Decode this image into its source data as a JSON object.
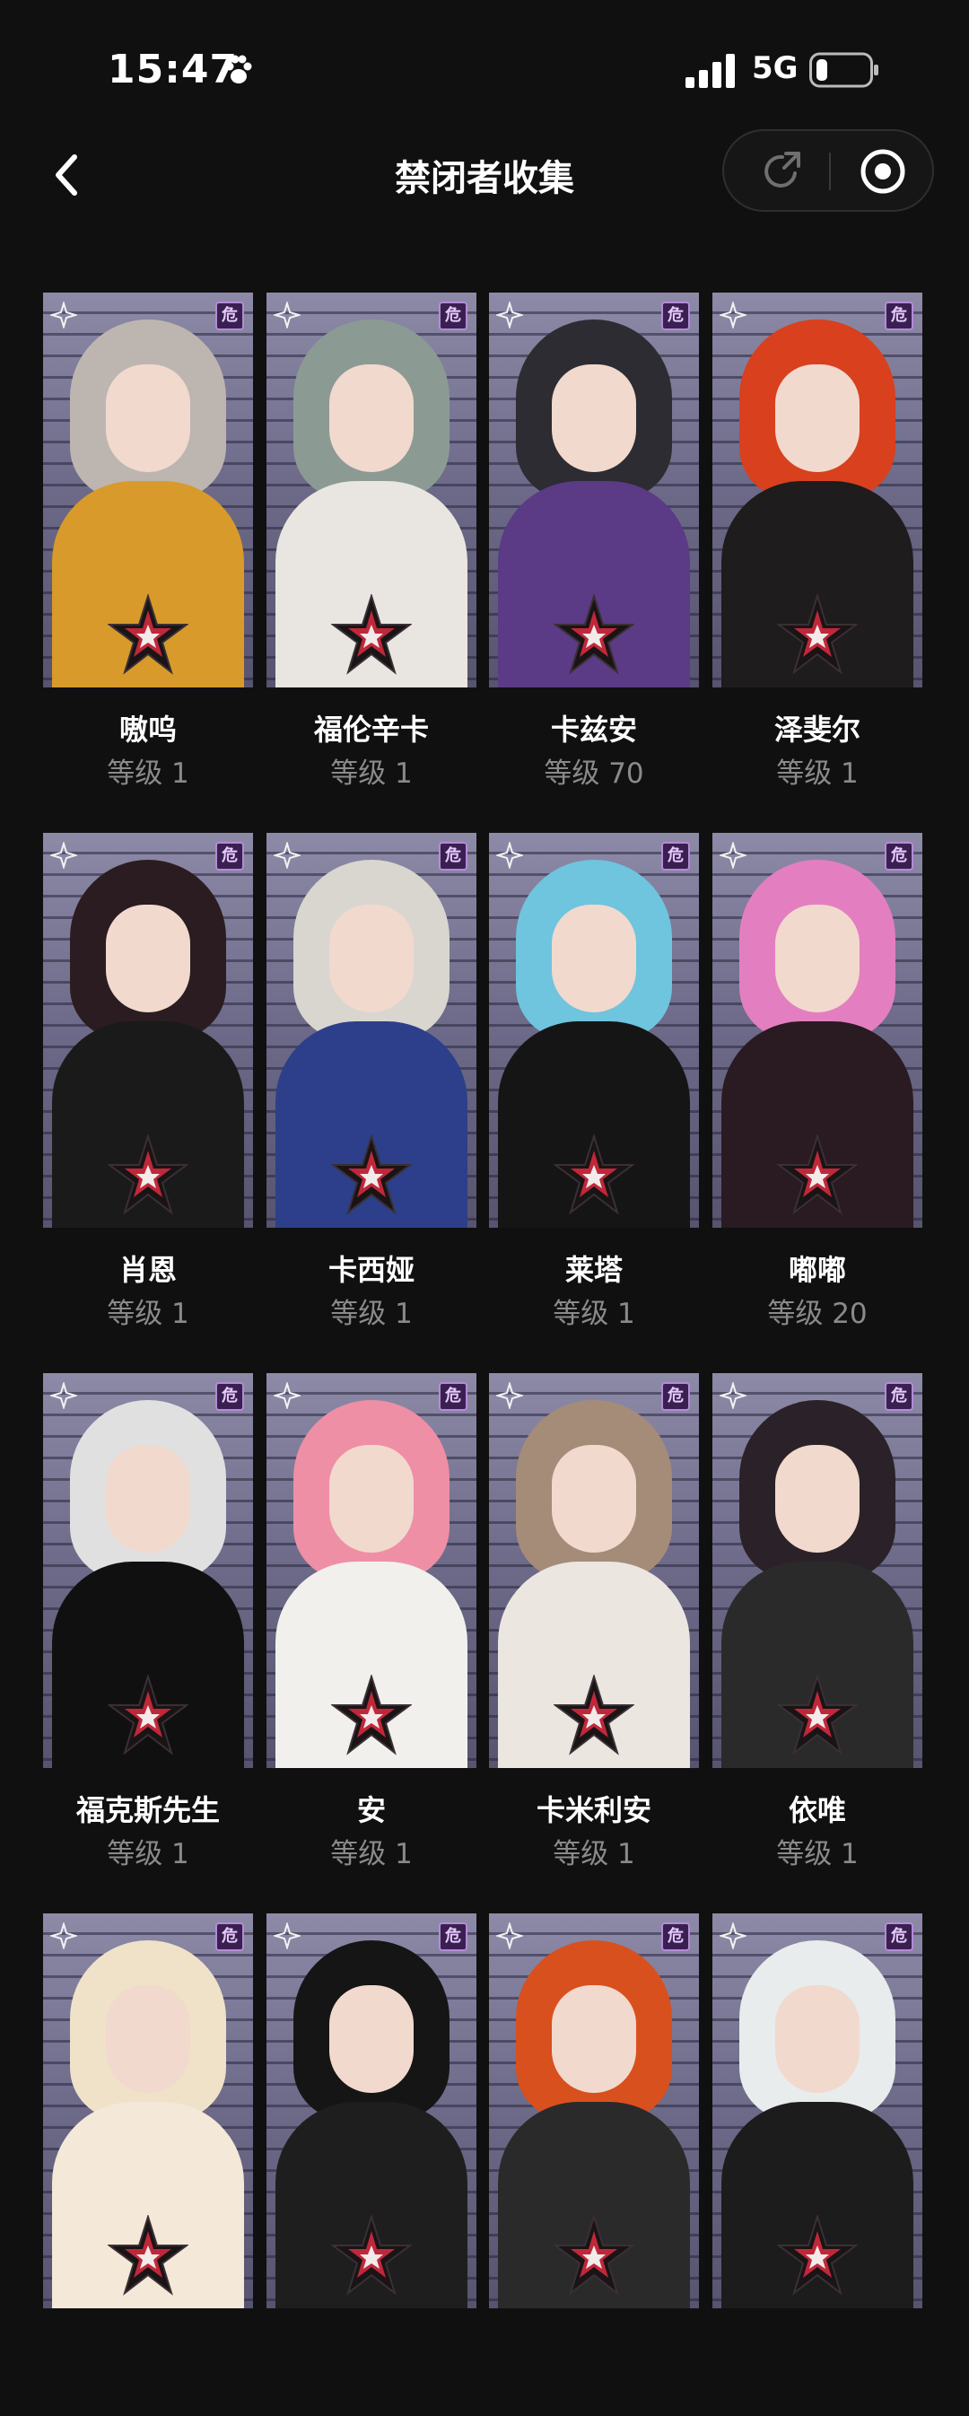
{
  "status": {
    "time": "15:47",
    "network": "5G"
  },
  "nav": {
    "title": "禁闭者收集"
  },
  "level_prefix": "等级",
  "cards": [
    {
      "name": "嗷呜",
      "level": "等级 1",
      "hair": "#bdb6b0",
      "body": "#d89a2a"
    },
    {
      "name": "福伦辛卡",
      "level": "等级 1",
      "hair": "#8c9a94",
      "body": "#e9e6e2"
    },
    {
      "name": "卡兹安",
      "level": "等级 70",
      "hair": "#2c2c32",
      "body": "#5b3a86"
    },
    {
      "name": "泽斐尔",
      "level": "等级 1",
      "hair": "#d8401e",
      "body": "#1e1c1c"
    },
    {
      "name": "肖恩",
      "level": "等级 1",
      "hair": "#2a1c20",
      "body": "#1a1a1a"
    },
    {
      "name": "卡西娅",
      "level": "等级 1",
      "hair": "#d9d6cf",
      "body": "#2d3f8a"
    },
    {
      "name": "莱塔",
      "level": "等级 1",
      "hair": "#6fc4de",
      "body": "#151515"
    },
    {
      "name": "嘟嘟",
      "level": "等级 20",
      "hair": "#e37fc0",
      "body": "#2a1a22"
    },
    {
      "name": "福克斯先生",
      "level": "等级 1",
      "hair": "#e0e0e0",
      "body": "#101010"
    },
    {
      "name": "安",
      "level": "等级 1",
      "hair": "#ee8fa6",
      "body": "#f2f0ec"
    },
    {
      "name": "卡米利安",
      "level": "等级 1",
      "hair": "#a58c78",
      "body": "#ebe6e0"
    },
    {
      "name": "依唯",
      "level": "等级 1",
      "hair": "#2a2228",
      "body": "#2a2a2a"
    },
    {
      "name": "",
      "level": "",
      "hair": "#efe2c8",
      "body": "#f4e8d8"
    },
    {
      "name": "",
      "level": "",
      "hair": "#151515",
      "body": "#1e1e1e"
    },
    {
      "name": "",
      "level": "",
      "hair": "#d8501e",
      "body": "#2a2a2a"
    },
    {
      "name": "",
      "level": "",
      "hair": "#e8ecec",
      "body": "#1c1c1c"
    }
  ],
  "badge_text": "危",
  "colors": {
    "background": "#101010",
    "level_text": "#8a8a8a",
    "emblem_red": "#c0283a",
    "badge_purple": "#b58ad8"
  },
  "icons": [
    "back-icon",
    "share-icon",
    "target-icon",
    "paw-icon",
    "signal-icon",
    "battery-icon",
    "star-emblem-icon"
  ]
}
